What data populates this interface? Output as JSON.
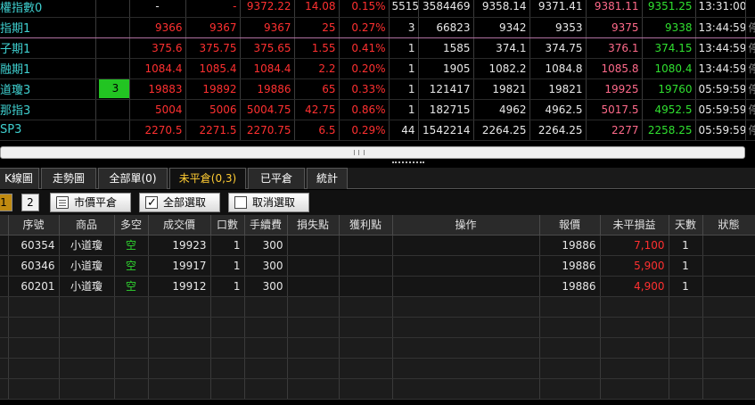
{
  "quotes": [
    {
      "name": "權指數0",
      "badge": "",
      "c1": "-",
      "c2": "-",
      "c3": "9372.22",
      "c4": "14.08",
      "c5": "0.15%",
      "c6": "5515",
      "c7": "3584469",
      "c8": "9358.14",
      "c9": "9371.41",
      "c10": "9381.11",
      "c11": "9351.25",
      "c12": "13:31:00",
      "c13": ""
    },
    {
      "name": "指期1",
      "badge": "",
      "c1": "9366",
      "c2": "9367",
      "c3": "9367",
      "c4": "25",
      "c5": "0.27%",
      "c6": "3",
      "c7": "66823",
      "c8": "9342",
      "c9": "9353",
      "c10": "9375",
      "c11": "9338",
      "c12": "13:44:59",
      "c13": "停止"
    },
    {
      "name": "子期1",
      "badge": "",
      "c1": "375.6",
      "c2": "375.75",
      "c3": "375.65",
      "c4": "1.55",
      "c5": "0.41%",
      "c6": "1",
      "c7": "1585",
      "c8": "374.1",
      "c9": "374.75",
      "c10": "376.1",
      "c11": "374.15",
      "c12": "13:44:59",
      "c13": "停止"
    },
    {
      "name": "融期1",
      "badge": "",
      "c1": "1084.4",
      "c2": "1085.4",
      "c3": "1084.4",
      "c4": "2.2",
      "c5": "0.20%",
      "c6": "1",
      "c7": "1905",
      "c8": "1082.2",
      "c9": "1084.8",
      "c10": "1085.8",
      "c11": "1080.4",
      "c12": "13:44:59",
      "c13": "停止"
    },
    {
      "name": "道瓊3",
      "badge": "3",
      "c1": "19883",
      "c2": "19892",
      "c3": "19886",
      "c4": "65",
      "c5": "0.33%",
      "c6": "1",
      "c7": "121417",
      "c8": "19821",
      "c9": "19821",
      "c10": "19925",
      "c11": "19760",
      "c12": "05:59:59",
      "c13": "停止"
    },
    {
      "name": "那指3",
      "badge": "",
      "c1": "5004",
      "c2": "5006",
      "c3": "5004.75",
      "c4": "42.75",
      "c5": "0.86%",
      "c6": "1",
      "c7": "182715",
      "c8": "4962",
      "c9": "4962.5",
      "c10": "5017.5",
      "c11": "4952.5",
      "c12": "05:59:59",
      "c13": "停止"
    },
    {
      "name": "SP3",
      "badge": "",
      "c1": "2270.5",
      "c2": "2271.5",
      "c3": "2270.75",
      "c4": "6.5",
      "c5": "0.29%",
      "c6": "44",
      "c7": "1542214",
      "c8": "2264.25",
      "c9": "2264.25",
      "c10": "2277",
      "c11": "2258.25",
      "c12": "05:59:59",
      "c13": "停止"
    }
  ],
  "tabs": {
    "kline": "K線圖",
    "trend": "走勢圖",
    "all_orders": "全部單(0)",
    "open": "未平倉(0,3)",
    "closed": "已平倉",
    "stats": "統計"
  },
  "toolbar": {
    "page1": "1",
    "page2": "2",
    "market_close": "市價平倉",
    "select_all": "全部選取",
    "deselect": "取消選取"
  },
  "grid": {
    "headers": [
      "序號",
      "商品",
      "多空",
      "成交價",
      "口數",
      "手續費",
      "損失點",
      "獲利點",
      "操作",
      "報價",
      "未平損益",
      "天數",
      "狀態"
    ],
    "rows": [
      {
        "seq": "60354",
        "product": "小道瓊",
        "side": "空",
        "price": "19923",
        "qty": "1",
        "fee": "300",
        "quote": "19886",
        "pnl": "7,100",
        "days": "1"
      },
      {
        "seq": "60346",
        "product": "小道瓊",
        "side": "空",
        "price": "19917",
        "qty": "1",
        "fee": "300",
        "quote": "19886",
        "pnl": "5,900",
        "days": "1"
      },
      {
        "seq": "60201",
        "product": "小道瓊",
        "side": "空",
        "price": "19912",
        "qty": "1",
        "fee": "300",
        "quote": "19886",
        "pnl": "4,900",
        "days": "1"
      }
    ]
  },
  "colors": {
    "up": "#ff3030",
    "down": "#2fd42f",
    "name": "#3fd0d0",
    "active_tab": "#ffcc33",
    "badge": "#22c422"
  }
}
